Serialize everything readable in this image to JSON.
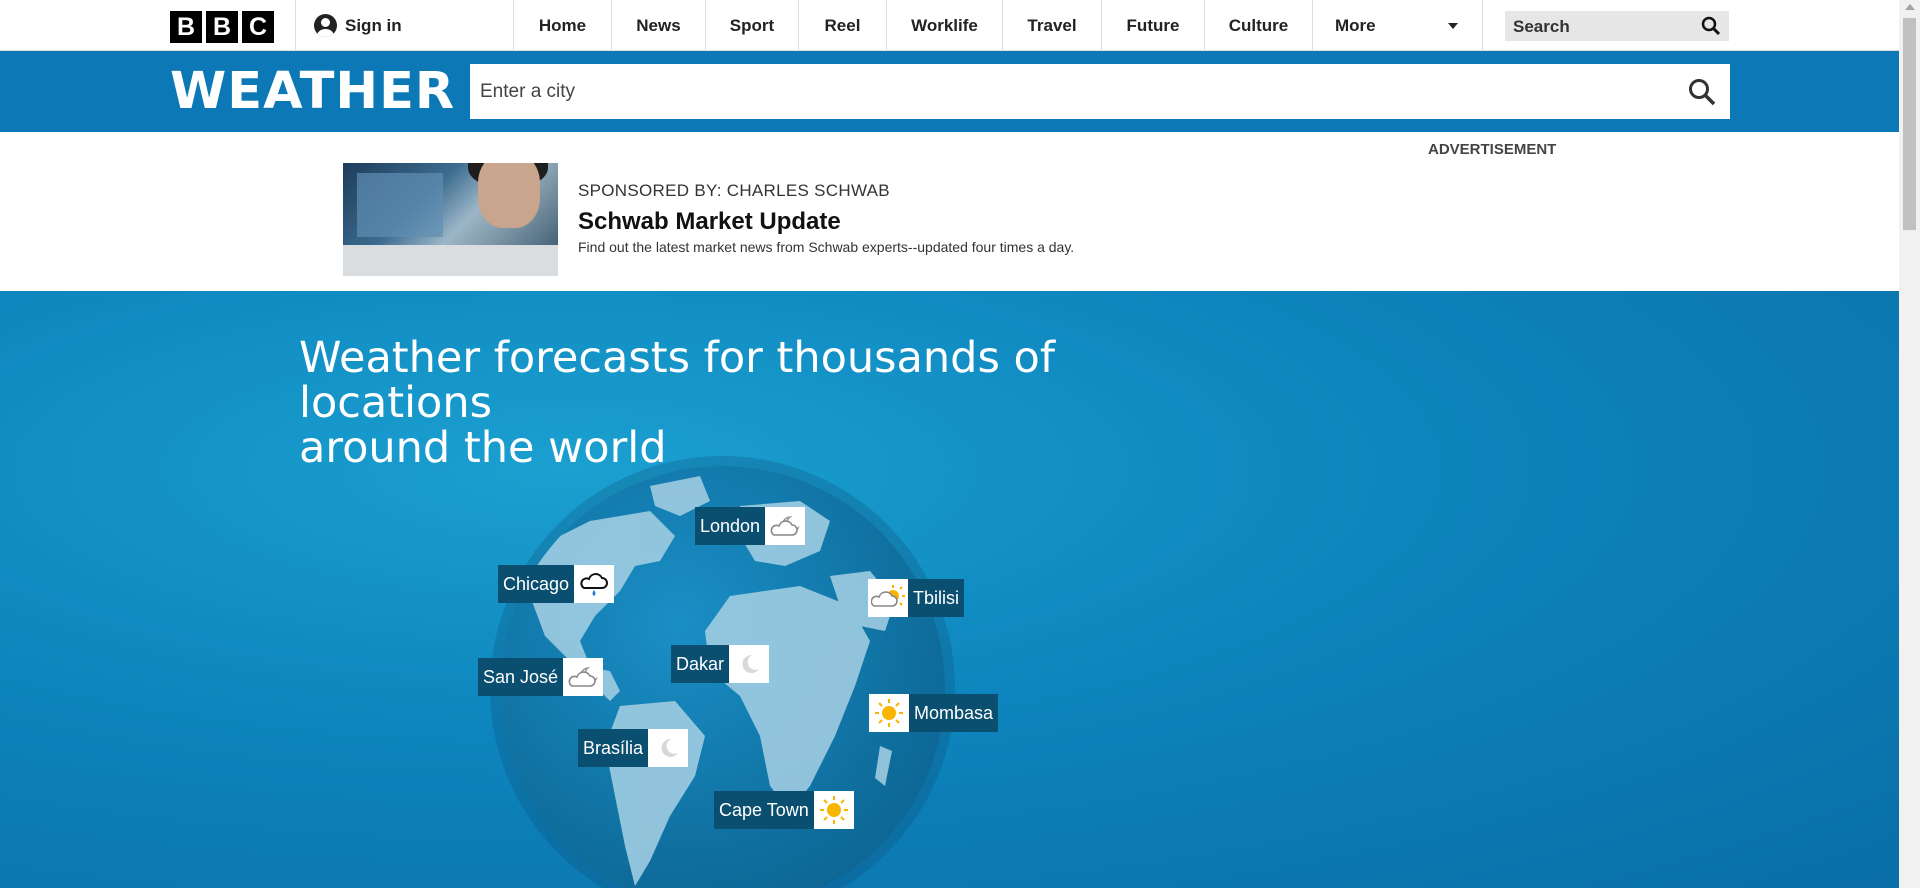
{
  "topnav": {
    "logo_letters": [
      "B",
      "B",
      "C"
    ],
    "signin_label": "Sign in",
    "items": [
      "Home",
      "News",
      "Sport",
      "Reel",
      "Worklife",
      "Travel",
      "Future",
      "Culture",
      "More"
    ],
    "search_label": "Search"
  },
  "weather": {
    "title": "WEATHER",
    "city_placeholder": "Enter a city"
  },
  "ad": {
    "label": "ADVERTISEMENT",
    "sponsor": "SPONSORED BY: CHARLES SCHWAB",
    "headline": "Schwab Market Update",
    "text": "Find out the latest market news from Schwab experts--updated four times a day."
  },
  "hero": {
    "title_line1": "Weather forecasts for thousands of locations",
    "title_line2": "around the world",
    "locations": [
      {
        "name": "London",
        "icon": "cloud-moon-icon"
      },
      {
        "name": "Chicago",
        "icon": "cloud-rain-icon"
      },
      {
        "name": "Tbilisi",
        "icon": "cloud-sun-icon"
      },
      {
        "name": "San José",
        "icon": "cloud-moon-icon"
      },
      {
        "name": "Dakar",
        "icon": "moon-icon"
      },
      {
        "name": "Mombasa",
        "icon": "sun-icon"
      },
      {
        "name": "Brasília",
        "icon": "moon-icon"
      },
      {
        "name": "Cape Town",
        "icon": "sun-icon"
      }
    ]
  },
  "colors": {
    "brand_blue": "#0c78b5",
    "label_bg": "#0b4f70",
    "sun": "#f7b500"
  }
}
